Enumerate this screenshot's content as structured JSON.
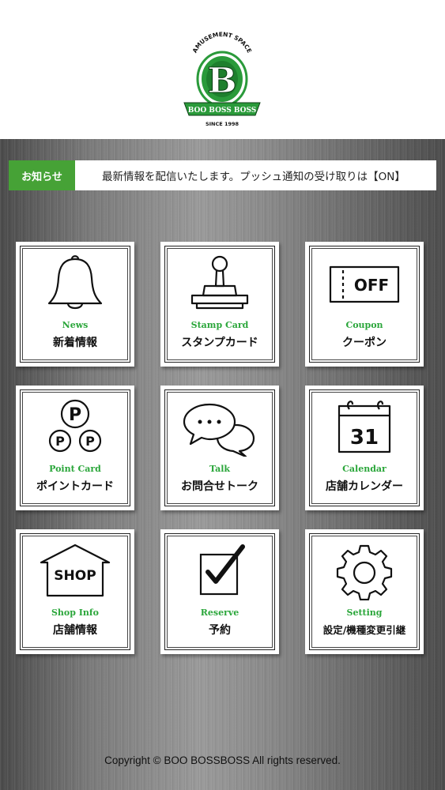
{
  "brand": {
    "arc_text": "AMUSEMENT SPACE",
    "letter": "B",
    "banner": "BOO BOSS BOSS",
    "since": "SINCE 1998",
    "accent": "#2a9a3a"
  },
  "news": {
    "label": "お知らせ",
    "message": "最新情報を配信いたします。プッシュ通知の受け取りは【ON】"
  },
  "tiles": [
    {
      "en": "News",
      "jp": "新着情報",
      "icon": "bell-icon"
    },
    {
      "en": "Stamp Card",
      "jp": "スタンプカード",
      "icon": "stamp-icon"
    },
    {
      "en": "Coupon",
      "jp": "クーポン",
      "icon": "coupon-icon",
      "icon_text": "OFF"
    },
    {
      "en": "Point Card",
      "jp": "ポイントカード",
      "icon": "points-icon",
      "icon_text": "P"
    },
    {
      "en": "Talk",
      "jp": "お問合せトーク",
      "icon": "chat-bubbles-icon"
    },
    {
      "en": "Calendar",
      "jp": "店舗カレンダー",
      "icon": "calendar-icon",
      "icon_text": "31"
    },
    {
      "en": "Shop Info",
      "jp": "店舗情報",
      "icon": "shop-icon",
      "icon_text": "SHOP"
    },
    {
      "en": "Reserve",
      "jp": "予約",
      "icon": "checkbox-icon"
    },
    {
      "en": "Setting",
      "jp": "設定/機種変更引継",
      "icon": "gear-icon"
    }
  ],
  "footer": {
    "copyright": "Copyright © BOO BOSSBOSS All rights reserved."
  }
}
